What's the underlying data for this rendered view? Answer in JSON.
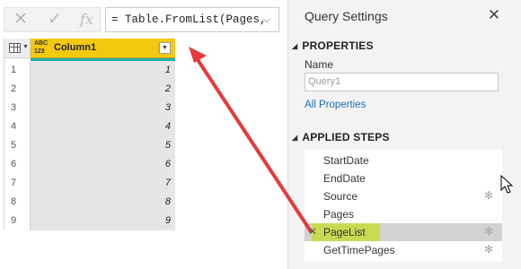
{
  "formula_bar": {
    "cancel_icon": "close-icon",
    "commit_icon": "check-icon",
    "fx_label": "fx",
    "formula": "= Table.FromList(Pages,",
    "expand_icon": "chevron-down-icon"
  },
  "grid": {
    "type_badge_top": "ABC",
    "type_badge_bottom": "123",
    "column_name": "Column1",
    "header_color": "#f2c811",
    "quality_bar_color": "#20b2aa",
    "rows": [
      {
        "num": "1",
        "value": "1"
      },
      {
        "num": "2",
        "value": "2"
      },
      {
        "num": "3",
        "value": "3"
      },
      {
        "num": "4",
        "value": "4"
      },
      {
        "num": "5",
        "value": "5"
      },
      {
        "num": "6",
        "value": "6"
      },
      {
        "num": "7",
        "value": "7"
      },
      {
        "num": "8",
        "value": "8"
      },
      {
        "num": "9",
        "value": "9"
      }
    ]
  },
  "query_settings": {
    "title": "Query Settings",
    "properties_title": "PROPERTIES",
    "name_label": "Name",
    "name_value": "Query1",
    "all_properties_link": "All Properties",
    "applied_steps_title": "APPLIED STEPS",
    "steps": [
      {
        "label": "StartDate",
        "has_gear": false,
        "selected": false
      },
      {
        "label": "EndDate",
        "has_gear": false,
        "selected": false
      },
      {
        "label": "Source",
        "has_gear": true,
        "selected": false
      },
      {
        "label": "Pages",
        "has_gear": false,
        "selected": false
      },
      {
        "label": "PageList",
        "has_gear": true,
        "selected": true
      },
      {
        "label": "GetTimePages",
        "has_gear": true,
        "selected": false
      }
    ],
    "link_color": "#1a6fb5",
    "highlight_color": "#c8dc3c"
  },
  "annotation": {
    "arrow_color": "#e8393a"
  }
}
